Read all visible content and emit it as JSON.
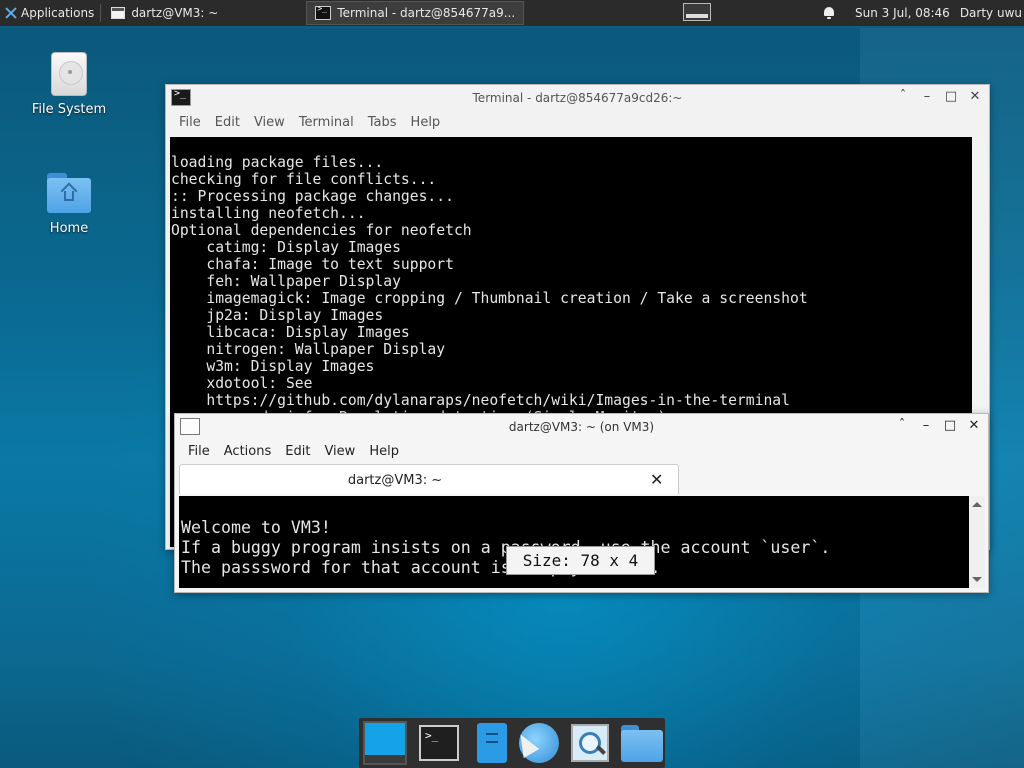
{
  "panel": {
    "applications_label": "Applications",
    "tasks": [
      {
        "label": "dartz@VM3: ~",
        "icon": "window-icon"
      },
      {
        "label": "Terminal - dartz@854677a9...",
        "icon": "terminal-icon"
      }
    ],
    "clock": "Sun  3 Jul, 08:46",
    "user": "Darty uwu"
  },
  "desktop": {
    "icons": [
      {
        "label": "File System",
        "icon": "drive-icon"
      },
      {
        "label": "Home",
        "icon": "home-folder-icon"
      }
    ]
  },
  "window_back": {
    "title": "Terminal - dartz@854677a9cd26:~",
    "menu": [
      "File",
      "Edit",
      "View",
      "Terminal",
      "Tabs",
      "Help"
    ],
    "lines": [
      "loading package files...",
      "checking for file conflicts...",
      ":: Processing package changes...",
      "installing neofetch...",
      "Optional dependencies for neofetch",
      "    catimg: Display Images",
      "    chafa: Image to text support",
      "    feh: Wallpaper Display",
      "    imagemagick: Image cropping / Thumbnail creation / Take a screenshot",
      "    jp2a: Display Images",
      "    libcaca: Display Images",
      "    nitrogen: Wallpaper Display",
      "    w3m: Display Images",
      "    xdotool: See",
      "    https://github.com/dylanaraps/neofetch/wiki/Images-in-the-terminal",
      "    xorg-xdpyinfo: Resolution detection (Single Monitor)"
    ]
  },
  "window_front": {
    "title": "dartz@VM3: ~ (on VM3)",
    "menu": [
      "File",
      "Actions",
      "Edit",
      "View",
      "Help"
    ],
    "tab_label": "dartz@VM3: ~",
    "lines": [
      "Welcome to VM3!",
      "If a buggy program insists on a password, use the account `user`.",
      "The passsword for that account is simply \"user\"."
    ],
    "size_tooltip": "Size: 78 x 4"
  },
  "dock": {
    "items": [
      "show-desktop-icon",
      "terminal-icon",
      "file-manager-icon",
      "web-browser-icon",
      "app-finder-icon",
      "folder-icon"
    ]
  },
  "colors": {
    "panel": "#2b2b2b",
    "terminal_bg": "#000000",
    "terminal_fg": "#e6e6e6",
    "accent": "#5aaeea"
  }
}
